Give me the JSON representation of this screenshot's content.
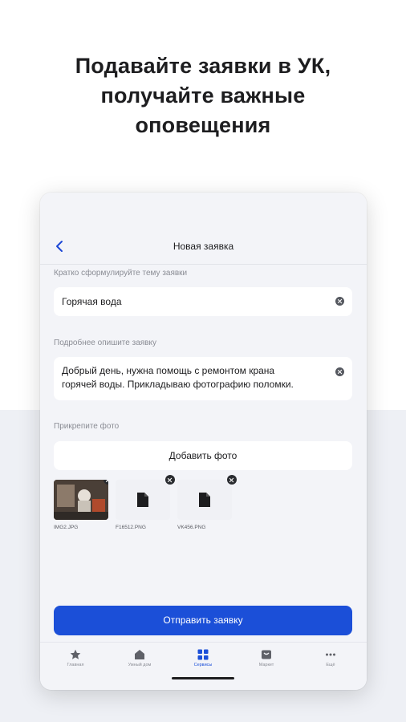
{
  "promo": {
    "headline_lines": [
      "Подавайте заявки в УК,",
      "получайте важные",
      "оповещения"
    ]
  },
  "screen": {
    "title": "Новая заявка",
    "back_icon": "chevron-left-icon",
    "subject": {
      "label": "Кратко сформулируйте тему заявки",
      "value": "Горячая вода"
    },
    "description": {
      "label": "Подробнее опишите заявку",
      "value_lines": [
        "Добрый день, нужна помощь с ремонтом крана",
        "горячей воды. Прикладываю фотографию поломки."
      ]
    },
    "photos": {
      "label": "Прикрепите фото",
      "add_button": "Добавить фото",
      "items": [
        {
          "name": "IMG2.JPG",
          "type": "photo"
        },
        {
          "name": "F16512.PNG",
          "type": "file"
        },
        {
          "name": "VK456.PNG",
          "type": "file"
        }
      ]
    },
    "submit_button": "Отправить заявку"
  },
  "tabbar": {
    "items": [
      {
        "label": "Главная",
        "icon": "star-icon"
      },
      {
        "label": "Умный дом",
        "icon": "house-icon"
      },
      {
        "label": "Сервисы",
        "icon": "grid-icon",
        "active": true
      },
      {
        "label": "Маркет",
        "icon": "market-icon"
      },
      {
        "label": "Ещё",
        "icon": "more-icon"
      }
    ]
  },
  "colors": {
    "accent": "#1b4fd8",
    "background_lower": "#eef0f5",
    "device_background": "#f3f4f8"
  }
}
